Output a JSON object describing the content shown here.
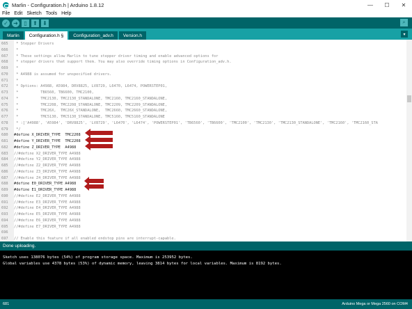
{
  "window": {
    "title": "Marlin - Configuration.h | Arduino 1.8.12",
    "minimize": "—",
    "maximize": "☐",
    "close": "✕"
  },
  "menu": [
    "File",
    "Edit",
    "Sketch",
    "Tools",
    "Help"
  ],
  "toolbar": {
    "verify_icon": "check-icon",
    "upload_icon": "arrow-right-icon",
    "new_icon": "new-file-icon",
    "open_icon": "arrow-up-icon",
    "save_icon": "arrow-down-icon",
    "serial_icon": "magnifier-icon"
  },
  "tabs": [
    "Marlin",
    "Configuration.h §",
    "Configuration_adv.h",
    "Version.h"
  ],
  "tab_menu_glyph": "▾",
  "editor_lines": [
    {
      "n": "665",
      "t": " * Stepper Drivers"
    },
    {
      "n": "666",
      "t": " *"
    },
    {
      "n": "667",
      "t": " * These settings allow Marlin to tune stepper driver timing and enable advanced options for"
    },
    {
      "n": "668",
      "t": " * stepper drivers that support them. You may also override timing options in Configuration_adv.h."
    },
    {
      "n": "669",
      "t": " *"
    },
    {
      "n": "670",
      "t": " * A4988 is assumed for unspecified drivers."
    },
    {
      "n": "671",
      "t": " *"
    },
    {
      "n": "672",
      "t": " * Options: A4988, A5984, DRV8825, LV8729, L6470, L6474, POWERSTEP01,"
    },
    {
      "n": "673",
      "t": " *          TB6560, TB6600, TMC2100,"
    },
    {
      "n": "674",
      "t": " *          TMC2130, TMC2130_STANDALONE, TMC2160, TMC2160_STANDALONE,"
    },
    {
      "n": "675",
      "t": " *          TMC2208, TMC2208_STANDALONE, TMC2209, TMC2209_STANDALONE,"
    },
    {
      "n": "676",
      "t": " *          TMC26X,  TMC26X_STANDALONE,  TMC2660, TMC2660_STANDALONE,"
    },
    {
      "n": "677",
      "t": " *          TMC5130, TMC5130_STANDALONE, TMC5160, TMC5160_STANDALONE"
    },
    {
      "n": "678",
      "t": " * :['A4988', 'A5984', 'DRV8825', 'LV8729', 'L6470', 'L6474', 'POWERSTEP01', 'TB6560', 'TB6600', 'TMC2100', 'TMC2130', 'TMC2130_STANDALONE', 'TMC2160', 'TMC2160_STA"
    },
    {
      "n": "679",
      "t": " */"
    },
    {
      "n": "680",
      "t": "#define X_DRIVER_TYPE  TMC2208",
      "code": true
    },
    {
      "n": "681",
      "t": "#define Y_DRIVER_TYPE  TMC2208",
      "code": true
    },
    {
      "n": "682",
      "t": "#define Z_DRIVER_TYPE  A4988",
      "code": true
    },
    {
      "n": "683",
      "t": "//#define X2_DRIVER_TYPE A4988"
    },
    {
      "n": "684",
      "t": "//#define Y2_DRIVER_TYPE A4988"
    },
    {
      "n": "685",
      "t": "//#define Z2_DRIVER_TYPE A4988"
    },
    {
      "n": "686",
      "t": "//#define Z3_DRIVER_TYPE A4988"
    },
    {
      "n": "687",
      "t": "//#define Z4_DRIVER_TYPE A4988"
    },
    {
      "n": "688",
      "t": "#define E0_DRIVER_TYPE A4988",
      "code": true
    },
    {
      "n": "689",
      "t": "#define E1_DRIVER_TYPE A4988",
      "code": true
    },
    {
      "n": "690",
      "t": "//#define E2_DRIVER_TYPE A4988"
    },
    {
      "n": "691",
      "t": "//#define E3_DRIVER_TYPE A4988"
    },
    {
      "n": "692",
      "t": "//#define E4_DRIVER_TYPE A4988"
    },
    {
      "n": "693",
      "t": "//#define E5_DRIVER_TYPE A4988"
    },
    {
      "n": "694",
      "t": "//#define E6_DRIVER_TYPE A4988"
    },
    {
      "n": "695",
      "t": "//#define E7_DRIVER_TYPE A4988"
    },
    {
      "n": "696",
      "t": ""
    },
    {
      "n": "697",
      "t": "// Enable this feature if all enabled endstop pins are interrupt-capable."
    }
  ],
  "status": "Done uploading.",
  "console": [
    "Sketch uses 138076 bytes (54%) of program storage space. Maximum is 253952 bytes.",
    "Global variables use 4378 bytes (53%) of dynamic memory, leaving 3814 bytes for local variables. Maximum is 8192 bytes."
  ],
  "footer": {
    "line": "681",
    "board": "Arduino Mega or Mega 2560 on COM4"
  },
  "colors": {
    "toolbar": "#006468",
    "tabbar": "#17a1a5",
    "arrow": "#b01c1c"
  }
}
